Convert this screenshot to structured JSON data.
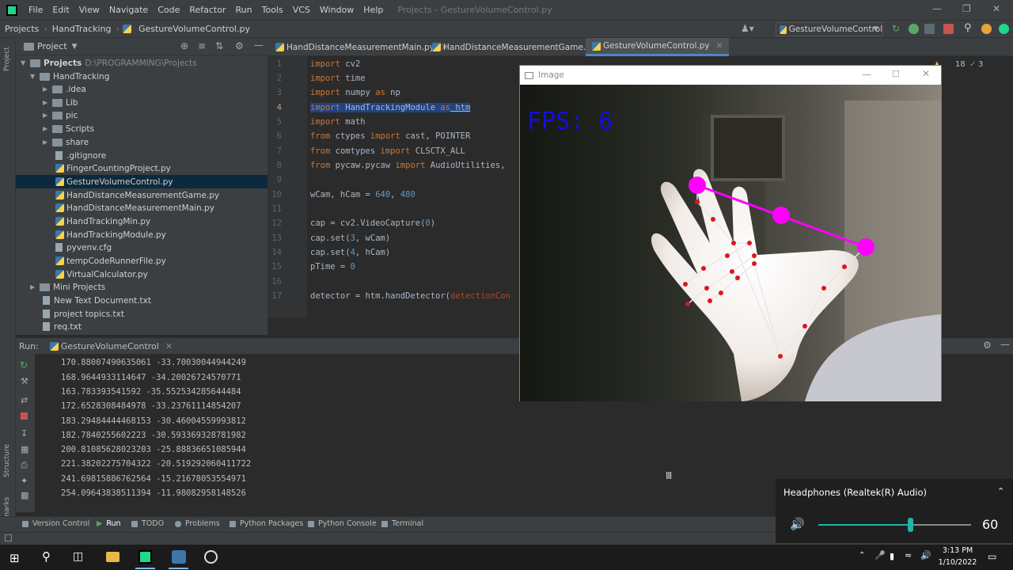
{
  "menubar": {
    "items": [
      "File",
      "Edit",
      "View",
      "Navigate",
      "Code",
      "Refactor",
      "Run",
      "Tools",
      "VCS",
      "Window",
      "Help"
    ],
    "window_title": "Projects - GestureVolumeControl.py"
  },
  "navbar": {
    "crumbs": [
      "Projects",
      "HandTracking",
      "GestureVolumeControl.py"
    ],
    "run_config": "GestureVolumeControl"
  },
  "leftstrip": {
    "project": "Project",
    "structure": "Structure",
    "bookmarks": "Bookmarks"
  },
  "project_panel": {
    "title": "Project",
    "tree": [
      {
        "label": "Projects",
        "extra": "D:\\PROGRAMMING\\Projects"
      },
      {
        "label": "HandTracking"
      },
      {
        "label": ".idea"
      },
      {
        "label": "Lib"
      },
      {
        "label": "pic"
      },
      {
        "label": "Scripts"
      },
      {
        "label": "share"
      },
      {
        "label": ".gitignore"
      },
      {
        "label": "FingerCountingProject.py"
      },
      {
        "label": "GestureVolumeControl.py"
      },
      {
        "label": "HandDistanceMeasurementGame.py"
      },
      {
        "label": "HandDistanceMeasurementMain.py"
      },
      {
        "label": "HandTrackingMin.py"
      },
      {
        "label": "HandTrackingModule.py"
      },
      {
        "label": "pyvenv.cfg"
      },
      {
        "label": "tempCodeRunnerFile.py"
      },
      {
        "label": "VirtualCalculator.py"
      },
      {
        "label": "Mini Projects"
      },
      {
        "label": "New Text Document.txt"
      },
      {
        "label": "project topics.txt"
      },
      {
        "label": "req.txt"
      }
    ]
  },
  "editor": {
    "tabs": [
      "HandDistanceMeasurementMain.py",
      "HandDistanceMeasurementGame.py",
      "GestureVolumeControl.py"
    ],
    "line_numbers": [
      "1",
      "2",
      "3",
      "4",
      "5",
      "6",
      "7",
      "8",
      "9",
      "10",
      "11",
      "12",
      "13",
      "14",
      "15",
      "16",
      "17"
    ],
    "code": {
      "l1_kw": "import",
      "l1_rest": " cv2",
      "l2_kw": "import",
      "l2_rest": " time",
      "l3_kw": "import",
      "l3_rest": " numpy ",
      "l3_as": "as",
      "l3_alias": " np",
      "l4_kw": "import",
      "l4_rest": " HandTrackingModule ",
      "l4_as": "as",
      "l4_alias": " htm",
      "l5_kw": "import",
      "l5_rest": " math",
      "l6_kw": "from",
      "l6_a": " ctypes ",
      "l6_kw2": "import",
      "l6_b": " cast, POINTER",
      "l7_kw": "from",
      "l7_a": " comtypes ",
      "l7_kw2": "import",
      "l7_b": " CLSCTX_ALL",
      "l8_kw": "from",
      "l8_a": " pycaw.pycaw ",
      "l8_kw2": "import",
      "l8_b": " AudioUtilities,",
      "l10_a": "wCam, hCam = ",
      "l10_n1": "640",
      "l10_c": ", ",
      "l10_n2": "480",
      "l12_a": "cap = cv2.VideoCapture(",
      "l12_n": "0",
      "l12_b": ")",
      "l13_a": "cap.set(",
      "l13_n": "3",
      "l13_b": ", wCam)",
      "l14_a": "cap.set(",
      "l14_n": "4",
      "l14_b": ", hCam)",
      "l15_a": "pTime = ",
      "l15_n": "0",
      "l17_a": "detector = htm.handDetector(",
      "l17_p": "detectionCon"
    },
    "inspections": {
      "warnings": "18",
      "weak": "3"
    }
  },
  "run_panel": {
    "label": "Run:",
    "config": "GestureVolumeControl",
    "output": [
      "170.88007490635061 -33.70030044944249",
      "168.9644933114647 -34.20026724570771",
      "163.783393541592 -35.552534285644484",
      "172.6528308484978 -33.23761114854207",
      "183.29484444468153 -30.46004559993812",
      "182.7840255602223 -30.593369328781982",
      "200.81085628023203 -25.88836651085944",
      "221.38202275704322 -20.519292060411722",
      "241.69815886762564 -15.21678053554971",
      "254.09643838511394 -11.98082958148526"
    ]
  },
  "bottom_tools": [
    "Version Control",
    "Run",
    "TODO",
    "Problems",
    "Python Packages",
    "Python Console",
    "Terminal"
  ],
  "image_window": {
    "title": "Image",
    "fps_text": "FPS: 6"
  },
  "volume_flyout": {
    "device": "Headphones (Realtek(R) Audio)",
    "level": "60",
    "level_fraction": 0.6,
    "accent": "#1fb5a8"
  },
  "taskbar": {
    "time": "3:13 PM",
    "date": "1/10/2022"
  },
  "colors": {
    "hand_landmark": "#e0141e",
    "fingertip_marker": "#ff00ff",
    "fps_text": "#1010e0"
  }
}
